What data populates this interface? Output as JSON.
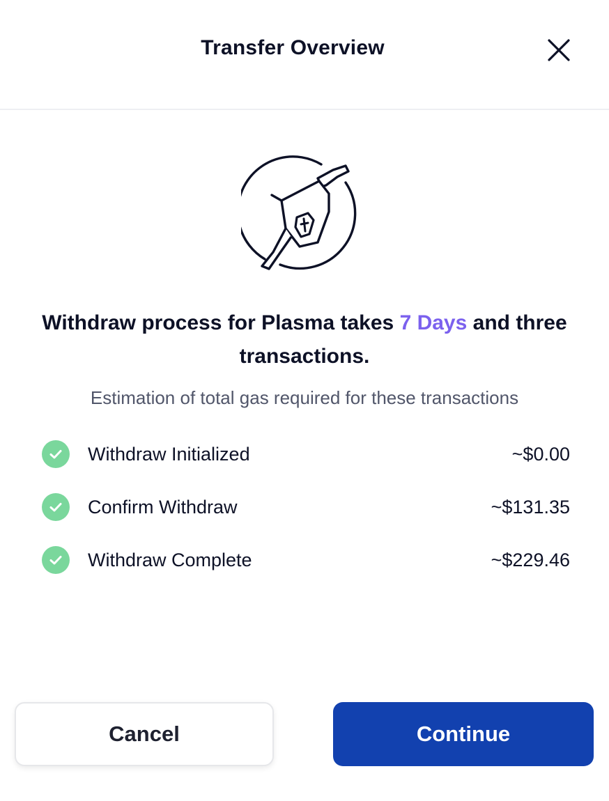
{
  "header": {
    "title": "Transfer Overview",
    "close_icon": "close-icon"
  },
  "hero": {
    "icon": "gas-pump-icon"
  },
  "headline": {
    "part1": "Withdraw process for Plasma takes ",
    "accent": "7 Days",
    "part2": " and three transactions.",
    "accent_color": "#7b61ee"
  },
  "subline": "Estimation of total gas required for these transactions",
  "transactions": [
    {
      "label": "Withdraw Initialized",
      "value": "~$0.00",
      "status_icon": "check-icon"
    },
    {
      "label": "Confirm Withdraw",
      "value": "~$131.35",
      "status_icon": "check-icon"
    },
    {
      "label": "Withdraw Complete",
      "value": "~$229.46",
      "status_icon": "check-icon"
    }
  ],
  "buttons": {
    "cancel_label": "Cancel",
    "continue_label": "Continue"
  },
  "colors": {
    "primary": "#1241af",
    "check": "#7ad79c",
    "accent": "#7b61ee"
  }
}
